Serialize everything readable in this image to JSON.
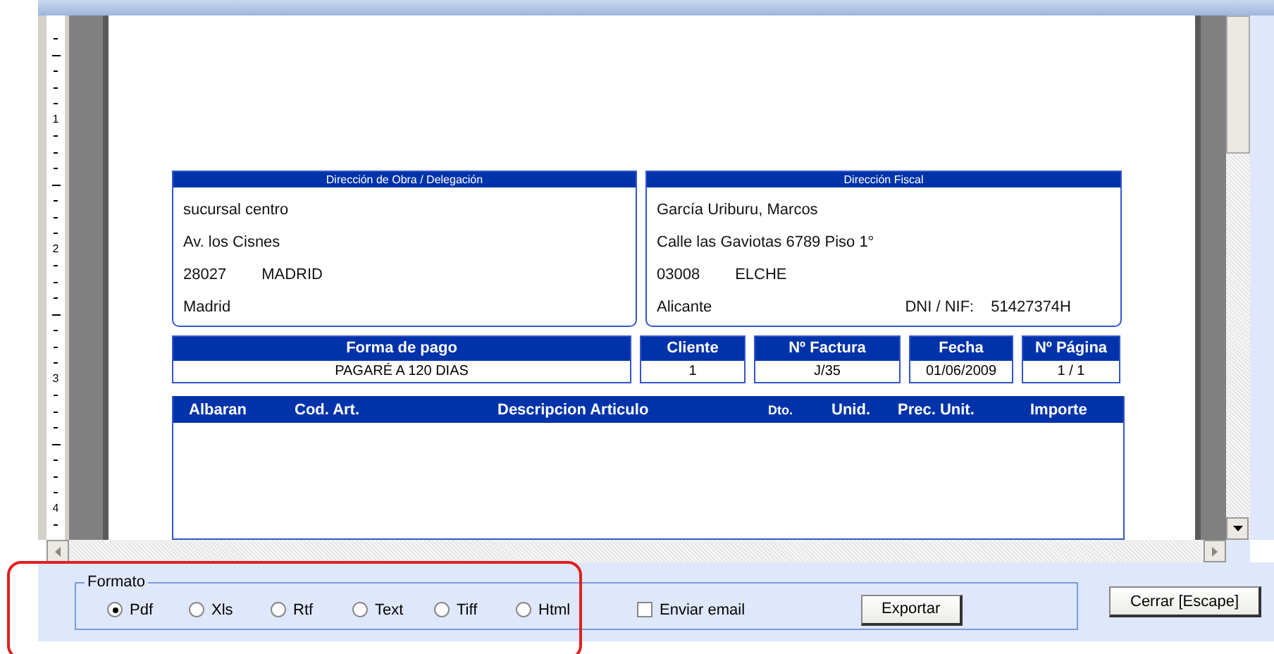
{
  "ruler": {
    "labels": [
      "1",
      "2",
      "3",
      "4"
    ]
  },
  "document": {
    "addresses": [
      {
        "title": "Dirección de Obra / Delegación",
        "lines": [
          {
            "kind": "plain",
            "parts": [
              "sucursal centro"
            ]
          },
          {
            "kind": "plain",
            "parts": [
              "Av. los Cisnes"
            ]
          },
          {
            "kind": "pair",
            "parts": [
              "28027",
              "MADRID"
            ]
          },
          {
            "kind": "plain",
            "parts": [
              "Madrid"
            ]
          }
        ]
      },
      {
        "title": "Dirección Fiscal",
        "lines": [
          {
            "kind": "plain",
            "parts": [
              "García Uriburu, Marcos"
            ]
          },
          {
            "kind": "plain",
            "parts": [
              "Calle las Gaviotas 6789 Piso 1°"
            ]
          },
          {
            "kind": "pair",
            "parts": [
              "03008",
              "ELCHE"
            ]
          },
          {
            "kind": "spread",
            "parts": [
              "Alicante",
              "DNI / NIF:",
              "51427374H"
            ]
          }
        ]
      }
    ],
    "fields": [
      {
        "label": "Forma de pago",
        "value": "PAGARÉ A 120 DIAS"
      },
      {
        "label": "Cliente",
        "value": "1"
      },
      {
        "label": "Nº Factura",
        "value": "J/35"
      },
      {
        "label": "Fecha",
        "value": "01/06/2009"
      },
      {
        "label": "Nº Página",
        "value": "1 / 1"
      }
    ],
    "table": {
      "columns": [
        "Albaran",
        "Cod. Art.",
        "Descripcion Articulo",
        "Dto.",
        "Unid.",
        "Prec. Unit.",
        "Importe"
      ]
    }
  },
  "export": {
    "group_title": "Formato",
    "formats": [
      {
        "label": "Pdf",
        "selected": true
      },
      {
        "label": "Xls",
        "selected": false
      },
      {
        "label": "Rtf",
        "selected": false
      },
      {
        "label": "Text",
        "selected": false
      },
      {
        "label": "Tiff",
        "selected": false
      },
      {
        "label": "Html",
        "selected": false
      }
    ],
    "email": {
      "label": "Enviar email",
      "checked": false
    },
    "export_button": "Exportar"
  },
  "close_button": "Cerrar [Escape]"
}
